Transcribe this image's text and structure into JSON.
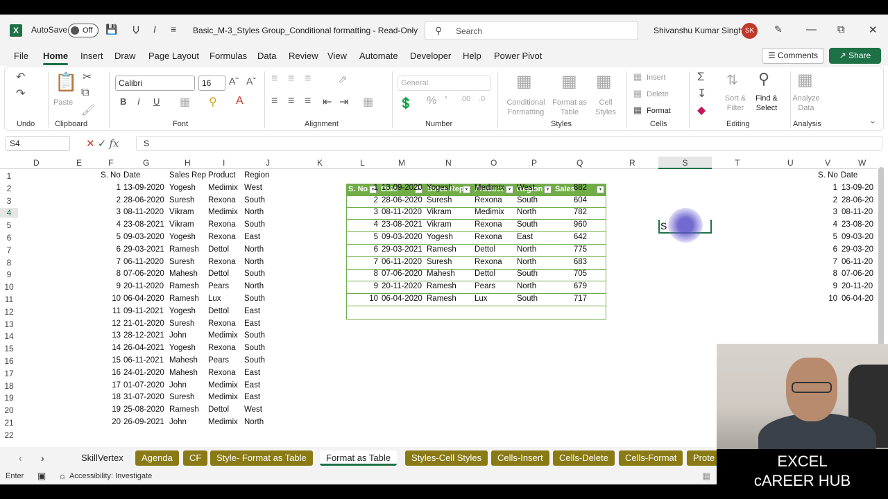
{
  "window": {
    "autosave_label": "AutoSave",
    "autosave_state": "Off",
    "file_title": "Basic_M-3_Styles Group_Conditional formatting  -  Read-Only",
    "search_placeholder": "Search",
    "user_name": "Shivanshu Kumar Singh",
    "user_initials": "SK"
  },
  "menu": {
    "items": [
      "File",
      "Home",
      "Insert",
      "Draw",
      "Page Layout",
      "Formulas",
      "Data",
      "Review",
      "View",
      "Automate",
      "Developer",
      "Help",
      "Power Pivot"
    ],
    "active": "Home",
    "comments_label": "Comments",
    "share_label": "Share"
  },
  "ribbon": {
    "groups": [
      "Undo",
      "Clipboard",
      "Font",
      "Alignment",
      "Number",
      "Styles",
      "Cells",
      "Editing",
      "Analysis"
    ],
    "paste_label": "Paste",
    "font_name": "Calibri",
    "font_size": "16",
    "number_format": "General",
    "conditional_formatting": "Conditional Formatting",
    "format_as_table": "Format as Table",
    "cell_styles": "Cell Styles",
    "insert_label": "Insert",
    "delete_label": "Delete",
    "format_label": "Format",
    "sort_filter": "Sort & Filter",
    "find_select": "Find & Select",
    "analyze_data": "Analyze Data"
  },
  "formula_bar": {
    "name_box": "S4",
    "fx": "fx",
    "content": "S"
  },
  "grid": {
    "columns": [
      "D",
      "E",
      "F",
      "G",
      "H",
      "I",
      "J",
      "K",
      "L",
      "M",
      "N",
      "O",
      "P",
      "Q",
      "R",
      "S",
      "T",
      "U",
      "V",
      "W"
    ],
    "selected_column": "S",
    "rows": [
      "1",
      "2",
      "3",
      "4",
      "5",
      "6",
      "7",
      "8",
      "9",
      "10",
      "11",
      "12",
      "13",
      "14",
      "15",
      "16",
      "17",
      "18",
      "19",
      "20",
      "21",
      "22"
    ],
    "left_headers": [
      "S. No",
      "Date",
      "Sales Rep",
      "Product",
      "Region"
    ],
    "left_rows": [
      [
        "1",
        "13-09-2020",
        "Yogesh",
        "Medimix",
        "West"
      ],
      [
        "2",
        "28-06-2020",
        "Suresh",
        "Rexona",
        "South"
      ],
      [
        "3",
        "08-11-2020",
        "Vikram",
        "Medimix",
        "North"
      ],
      [
        "4",
        "23-08-2021",
        "Vikram",
        "Rexona",
        "South"
      ],
      [
        "5",
        "09-03-2020",
        "Yogesh",
        "Rexona",
        "East"
      ],
      [
        "6",
        "29-03-2021",
        "Ramesh",
        "Dettol",
        "North"
      ],
      [
        "7",
        "06-11-2020",
        "Suresh",
        "Rexona",
        "North"
      ],
      [
        "8",
        "07-06-2020",
        "Mahesh",
        "Dettol",
        "South"
      ],
      [
        "9",
        "20-11-2020",
        "Ramesh",
        "Pears",
        "North"
      ],
      [
        "10",
        "06-04-2020",
        "Ramesh",
        "Lux",
        "South"
      ],
      [
        "11",
        "09-11-2021",
        "Yogesh",
        "Dettol",
        "East"
      ],
      [
        "12",
        "21-01-2020",
        "Suresh",
        "Rexona",
        "East"
      ],
      [
        "13",
        "28-12-2021",
        "John",
        "Medimix",
        "South"
      ],
      [
        "14",
        "26-04-2021",
        "Yogesh",
        "Rexona",
        "South"
      ],
      [
        "15",
        "06-11-2021",
        "Mahesh",
        "Pears",
        "South"
      ],
      [
        "16",
        "24-01-2020",
        "Mahesh",
        "Rexona",
        "East"
      ],
      [
        "17",
        "01-07-2020",
        "John",
        "Medimix",
        "East"
      ],
      [
        "18",
        "31-07-2020",
        "Suresh",
        "Medimix",
        "East"
      ],
      [
        "19",
        "25-08-2020",
        "Ramesh",
        "Dettol",
        "West"
      ],
      [
        "20",
        "26-09-2021",
        "John",
        "Medimix",
        "North"
      ]
    ],
    "table_headers": [
      "S. No",
      "Date",
      "Sales Rep",
      "Product",
      "Region",
      "Sales"
    ],
    "table_rows": [
      [
        "1",
        "13-09-2020",
        "Yogesh",
        "Medimix",
        "West",
        "882"
      ],
      [
        "2",
        "28-06-2020",
        "Suresh",
        "Rexona",
        "South",
        "604"
      ],
      [
        "3",
        "08-11-2020",
        "Vikram",
        "Medimix",
        "North",
        "782"
      ],
      [
        "4",
        "23-08-2021",
        "Vikram",
        "Rexona",
        "South",
        "960"
      ],
      [
        "5",
        "09-03-2020",
        "Yogesh",
        "Rexona",
        "East",
        "642"
      ],
      [
        "6",
        "29-03-2021",
        "Ramesh",
        "Dettol",
        "North",
        "775"
      ],
      [
        "7",
        "06-11-2020",
        "Suresh",
        "Rexona",
        "North",
        "683"
      ],
      [
        "8",
        "07-06-2020",
        "Mahesh",
        "Dettol",
        "South",
        "705"
      ],
      [
        "9",
        "20-11-2020",
        "Ramesh",
        "Pears",
        "North",
        "679"
      ],
      [
        "10",
        "06-04-2020",
        "Ramesh",
        "Lux",
        "South",
        "717"
      ]
    ],
    "right_headers": [
      "S. No",
      "Date"
    ],
    "right_rows": [
      [
        "1",
        "13-09-20"
      ],
      [
        "2",
        "28-06-20"
      ],
      [
        "3",
        "08-11-20"
      ],
      [
        "4",
        "23-08-20"
      ],
      [
        "5",
        "09-03-20"
      ],
      [
        "6",
        "29-03-20"
      ],
      [
        "7",
        "06-11-20"
      ],
      [
        "8",
        "07-06-20"
      ],
      [
        "9",
        "20-11-20"
      ],
      [
        "10",
        "06-04-20"
      ]
    ],
    "active_cell_text": "S"
  },
  "sheet_tabs": [
    "SkillVertex",
    "Agenda",
    "CF",
    "Style- Format as Table",
    "Format as Table",
    "Styles-Cell Styles",
    "Cells-Insert",
    "Cells-Delete",
    "Cells-Format",
    "Prote"
  ],
  "active_tab": "Format as Table",
  "status": {
    "mode": "Enter",
    "accessibility": "Accessibility: Investigate"
  },
  "brand": {
    "line1": "EXCEL",
    "line2": "cAREER HUB"
  },
  "colors": {
    "excel_green": "#1e7145",
    "table_green": "#70ad47",
    "tab_olive": "#8a7a15"
  }
}
